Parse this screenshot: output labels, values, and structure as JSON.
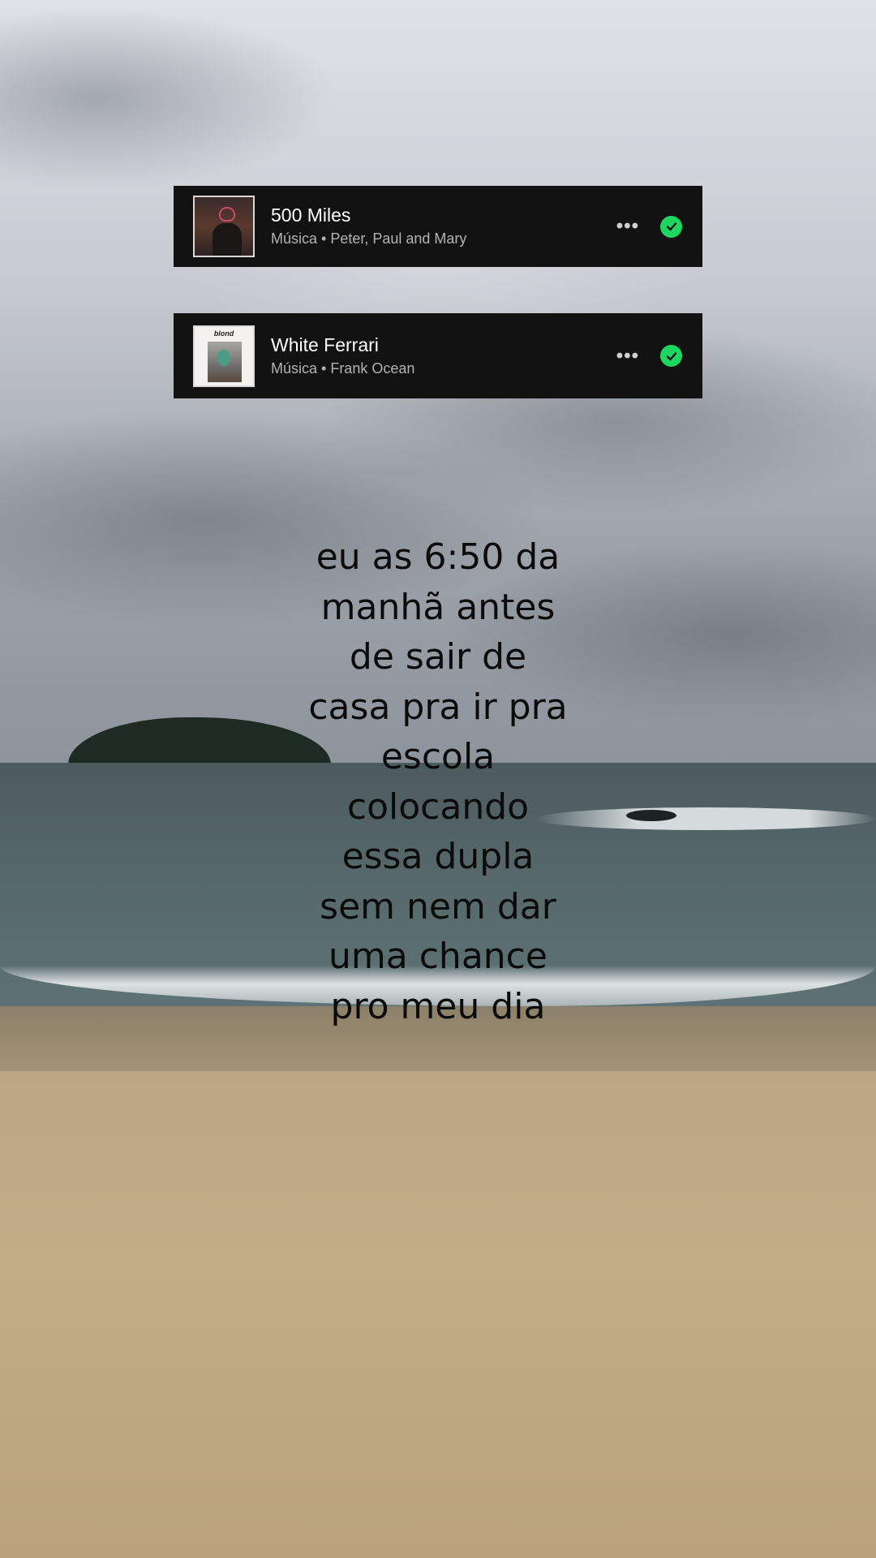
{
  "tracks": [
    {
      "title": "500 Miles",
      "subtitle": "Música • Peter, Paul and Mary",
      "cover_art": "peter-paul-and-mary-album-cover",
      "saved": true
    },
    {
      "title": "White Ferrari",
      "subtitle": "Música • Frank Ocean",
      "cover_art": "blond-album-cover",
      "cover_text": "blond",
      "saved": true
    }
  ],
  "icons": {
    "more": "more-horizontal-icon",
    "saved": "check-circle-icon"
  },
  "colors": {
    "card_bg": "#121212",
    "check_green": "#1ed760",
    "caption_text": "#0b0b0b"
  },
  "caption": {
    "lines": [
      "eu as 6:50 da",
      "manhã antes",
      "de sair de",
      "casa pra ir pra",
      "escola",
      "colocando",
      "essa dupla",
      "sem nem dar",
      "uma chance",
      "pro meu dia"
    ]
  },
  "background": "cloudy beach scene with island and sea"
}
